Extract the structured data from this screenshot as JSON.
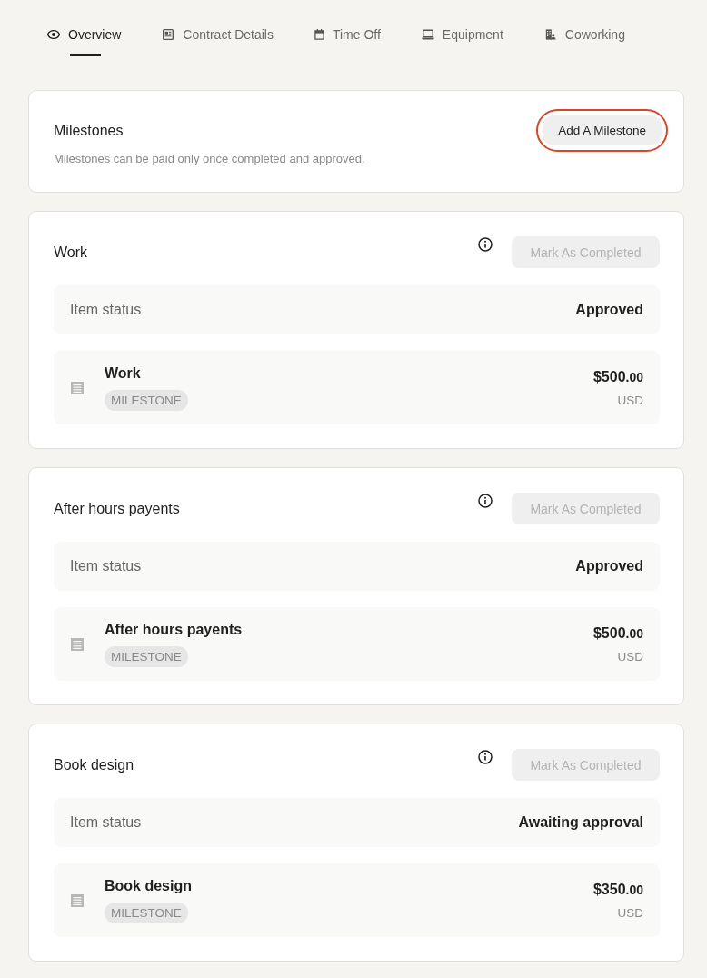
{
  "tabs": [
    {
      "label": "Overview",
      "selected": true
    },
    {
      "label": "Contract Details",
      "selected": false
    },
    {
      "label": "Time Off",
      "selected": false
    },
    {
      "label": "Equipment",
      "selected": false
    },
    {
      "label": "Coworking",
      "selected": false
    }
  ],
  "header": {
    "title": "Milestones",
    "subtitle": "Milestones can be paid only once completed and approved.",
    "add_button": {
      "label": "Add A Milestone",
      "focused": true
    }
  },
  "milestones": [
    {
      "title": "Work",
      "complete_button": {
        "label": "Mark As Completed",
        "disabled": true
      },
      "status_label": "Item status",
      "status": "Approved",
      "item": {
        "name": "Work",
        "badge": "MILESTONE",
        "amount": "$500.00",
        "currency": "USD"
      }
    },
    {
      "title": "After hours payents",
      "complete_button": {
        "label": "Mark As Completed",
        "disabled": true
      },
      "status_label": "Item status",
      "status": "Approved",
      "item": {
        "name": "After hours payents",
        "badge": "MILESTONE",
        "amount": "$500.00",
        "currency": "USD"
      }
    },
    {
      "title": "Book design",
      "complete_button": {
        "label": "Mark As Completed",
        "disabled": true
      },
      "status_label": "Item status",
      "status": "Awaiting approval",
      "item": {
        "name": "Book design",
        "badge": "MILESTONE",
        "amount": "$350.00",
        "currency": "USD"
      }
    }
  ]
}
